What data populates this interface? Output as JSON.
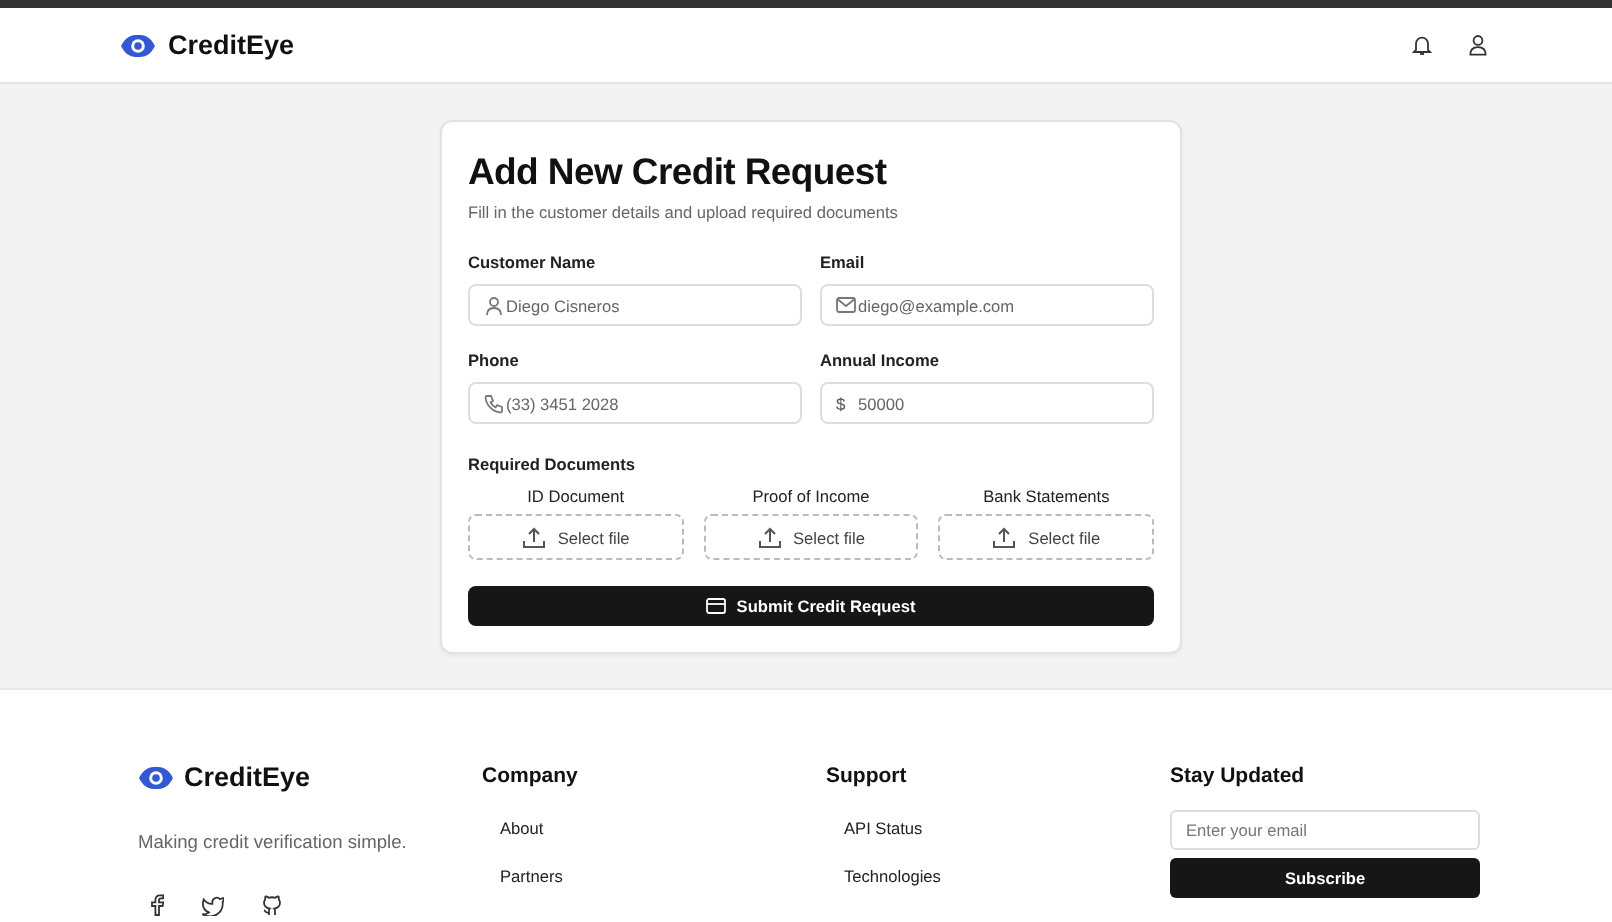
{
  "header": {
    "brand": "CreditEye"
  },
  "form": {
    "title": "Add New Credit Request",
    "subtitle": "Fill in the customer details and upload required documents",
    "fields": [
      {
        "label": "Customer Name",
        "kind": "person",
        "placeholder": "Diego Cisneros"
      },
      {
        "label": "Email",
        "kind": "mail",
        "placeholder": "diego@example.com"
      },
      {
        "label": "Phone",
        "kind": "phone",
        "placeholder": "(33) 3451 2028"
      },
      {
        "label": "Annual Income",
        "kind": "currency",
        "prefix": "$",
        "placeholder": "50000"
      }
    ],
    "documents_label": "Required Documents",
    "documents": [
      {
        "label": "ID Document",
        "button": "Select file"
      },
      {
        "label": "Proof of Income",
        "button": "Select file"
      },
      {
        "label": "Bank Statements",
        "button": "Select file"
      }
    ],
    "submit": "Submit Credit Request"
  },
  "footer": {
    "brand": "CreditEye",
    "tagline": "Making credit verification simple.",
    "columns": [
      {
        "heading": "Company",
        "links": [
          "About",
          "Partners"
        ]
      },
      {
        "heading": "Support",
        "links": [
          "API Status",
          "Technologies"
        ]
      }
    ],
    "newsletter": {
      "heading": "Stay Updated",
      "placeholder": "Enter your email",
      "button": "Subscribe"
    }
  }
}
